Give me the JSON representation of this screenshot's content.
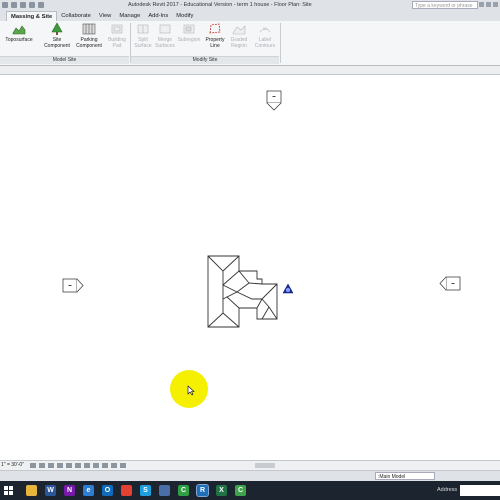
{
  "window": {
    "title": "Autodesk Revit 2017 - Educational Version -   term 1 house - Floor Plan: Site",
    "search_placeholder": "Type a keyword or phrase"
  },
  "tabs": [
    {
      "label": "Massing & Site",
      "active": true
    },
    {
      "label": "Collaborate",
      "active": false
    },
    {
      "label": "View",
      "active": false
    },
    {
      "label": "Manage",
      "active": false
    },
    {
      "label": "Add-Ins",
      "active": false
    },
    {
      "label": "Modify",
      "active": false
    }
  ],
  "ribbon": {
    "model_site": {
      "label": "Model Site",
      "buttons": [
        {
          "line1": "Toposurface",
          "line2": "",
          "enabled": true,
          "icon": "toposurface-icon"
        },
        {
          "line1": "Site",
          "line2": "Component",
          "enabled": true,
          "icon": "tree-icon"
        },
        {
          "line1": "Parking",
          "line2": "Component",
          "enabled": true,
          "icon": "parking-icon"
        },
        {
          "line1": "Building",
          "line2": "Pad",
          "enabled": false,
          "icon": "building-pad-icon"
        }
      ]
    },
    "modify_site": {
      "label": "Modify Site",
      "buttons": [
        {
          "line1": "Split",
          "line2": "Surface",
          "enabled": false,
          "icon": "split-surface-icon"
        },
        {
          "line1": "Merge",
          "line2": "Surfaces",
          "enabled": false,
          "icon": "merge-surfaces-icon"
        },
        {
          "line1": "Subregion",
          "line2": "",
          "enabled": false,
          "icon": "subregion-icon"
        },
        {
          "line1": "Property",
          "line2": "Line",
          "enabled": true,
          "icon": "property-line-icon"
        },
        {
          "line1": "Graded",
          "line2": "Region",
          "enabled": false,
          "icon": "graded-region-icon"
        },
        {
          "line1": "Label",
          "line2": "Contours",
          "enabled": false,
          "icon": "label-contours-icon"
        }
      ]
    }
  },
  "view_control": {
    "scale": "1\" = 30'-0\""
  },
  "statusbar": {
    "model": ":Main Model"
  },
  "taskbar": {
    "address_label": "Address",
    "apps": [
      {
        "icon": "file-explorer-icon",
        "color": "#e7b53b",
        "letter": ""
      },
      {
        "icon": "word-icon",
        "color": "#2b579a",
        "letter": "W"
      },
      {
        "icon": "onenote-icon",
        "color": "#7719aa",
        "letter": "N"
      },
      {
        "icon": "edge-icon",
        "color": "#2d7dd2",
        "letter": "e"
      },
      {
        "icon": "outlook-icon",
        "color": "#0f6cbd",
        "letter": "O"
      },
      {
        "icon": "chrome-icon",
        "color": "#e34133",
        "letter": ""
      },
      {
        "icon": "skype-icon",
        "color": "#1ea0e0",
        "letter": "S"
      },
      {
        "icon": "mail-icon",
        "color": "#4a6ea8",
        "letter": ""
      },
      {
        "icon": "camtasia-icon",
        "color": "#2f9e44",
        "letter": "C"
      },
      {
        "icon": "revit-icon",
        "color": "#1f6fb8",
        "letter": "R"
      },
      {
        "icon": "excel-icon",
        "color": "#217346",
        "letter": "X"
      },
      {
        "icon": "camtasia-recorder-icon",
        "color": "#3fa34d",
        "letter": "C"
      }
    ]
  },
  "colors": {
    "accent": "#1f4e9c",
    "cursor_highlight": "#f4f000"
  }
}
